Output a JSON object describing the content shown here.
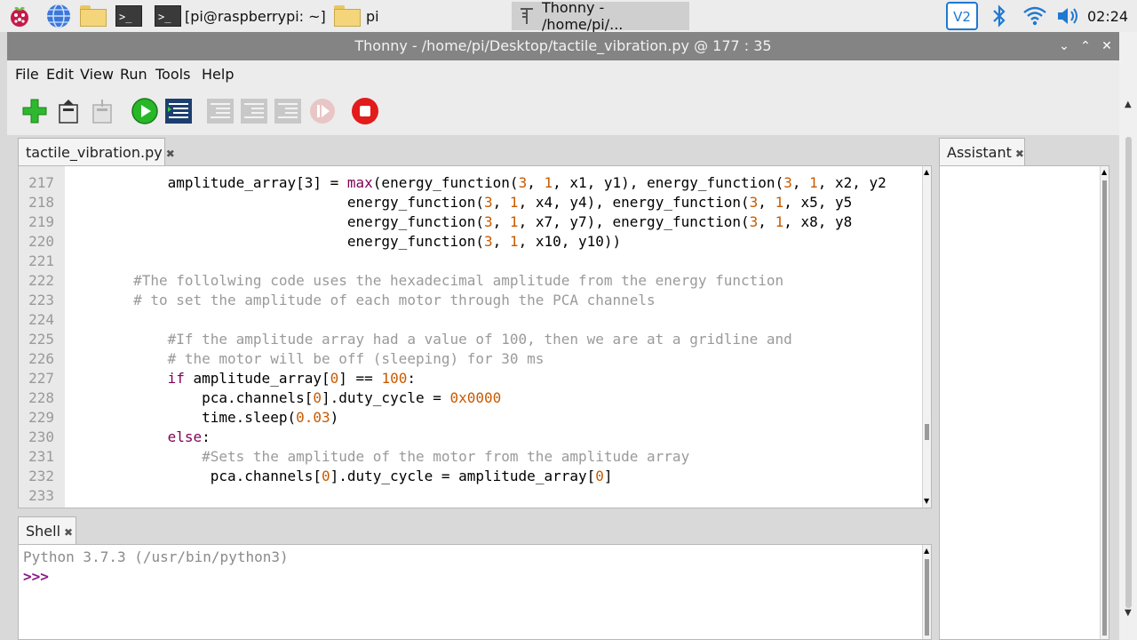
{
  "panel": {
    "tasks": [
      {
        "label": "[pi@raspberrypi: ~]",
        "icon": "terminal-icon"
      },
      {
        "label": "pi",
        "icon": "folder-icon"
      },
      {
        "label": "Thonny  -  /home/pi/...",
        "icon": "thonny-icon"
      }
    ],
    "clock": "02:24",
    "tray_icons": [
      "vnc-icon",
      "bluetooth-icon",
      "wifi-icon",
      "volume-icon"
    ],
    "launcher_icons": [
      "raspberry-menu-icon",
      "web-browser-icon",
      "file-manager-icon",
      "terminal-icon"
    ]
  },
  "window": {
    "title": "Thonny  -  /home/pi/Desktop/tactile_vibration.py  @  177 : 35"
  },
  "menu": [
    "File",
    "Edit",
    "View",
    "Run",
    "Tools",
    "Help"
  ],
  "toolbar": [
    "new-file",
    "open-file",
    "save-file",
    "run",
    "debug",
    "step-over",
    "step-into",
    "step-out",
    "resume",
    "stop"
  ],
  "editor": {
    "tab_label": "tactile_vibration.py",
    "lines": [
      {
        "n": "217",
        "segs": [
          [
            "t",
            "            amplitude_array[3] = "
          ],
          [
            "k",
            "max"
          ],
          [
            "t",
            "(energy_function("
          ],
          [
            "n",
            "3"
          ],
          [
            "t",
            ", "
          ],
          [
            "n",
            "1"
          ],
          [
            "t",
            ", x1, y1), energy_function("
          ],
          [
            "n",
            "3"
          ],
          [
            "t",
            ", "
          ],
          [
            "n",
            "1"
          ],
          [
            "t",
            ", x2, y2"
          ]
        ]
      },
      {
        "n": "218",
        "segs": [
          [
            "t",
            "                                 energy_function("
          ],
          [
            "n",
            "3"
          ],
          [
            "t",
            ", "
          ],
          [
            "n",
            "1"
          ],
          [
            "t",
            ", x4, y4), energy_function("
          ],
          [
            "n",
            "3"
          ],
          [
            "t",
            ", "
          ],
          [
            "n",
            "1"
          ],
          [
            "t",
            ", x5, y5"
          ]
        ]
      },
      {
        "n": "219",
        "segs": [
          [
            "t",
            "                                 energy_function("
          ],
          [
            "n",
            "3"
          ],
          [
            "t",
            ", "
          ],
          [
            "n",
            "1"
          ],
          [
            "t",
            ", x7, y7), energy_function("
          ],
          [
            "n",
            "3"
          ],
          [
            "t",
            ", "
          ],
          [
            "n",
            "1"
          ],
          [
            "t",
            ", x8, y8"
          ]
        ]
      },
      {
        "n": "220",
        "segs": [
          [
            "t",
            "                                 energy_function("
          ],
          [
            "n",
            "3"
          ],
          [
            "t",
            ", "
          ],
          [
            "n",
            "1"
          ],
          [
            "t",
            ", x10, y10))"
          ]
        ]
      },
      {
        "n": "221",
        "segs": []
      },
      {
        "n": "222",
        "segs": [
          [
            "c",
            "        #The follolwing code uses the hexadecimal amplitude from the energy function"
          ]
        ]
      },
      {
        "n": "223",
        "segs": [
          [
            "c",
            "        # to set the amplitude of each motor through the PCA channels"
          ]
        ]
      },
      {
        "n": "224",
        "segs": []
      },
      {
        "n": "225",
        "segs": [
          [
            "c",
            "            #If the amplitude array had a value of 100, then we are at a gridline and"
          ]
        ]
      },
      {
        "n": "226",
        "segs": [
          [
            "c",
            "            # the motor will be off (sleeping) for 30 ms"
          ]
        ]
      },
      {
        "n": "227",
        "segs": [
          [
            "t",
            "            "
          ],
          [
            "k",
            "if"
          ],
          [
            "t",
            " amplitude_array["
          ],
          [
            "n",
            "0"
          ],
          [
            "t",
            "] == "
          ],
          [
            "n",
            "100"
          ],
          [
            "t",
            ":"
          ]
        ]
      },
      {
        "n": "228",
        "segs": [
          [
            "t",
            "                pca.channels["
          ],
          [
            "n",
            "0"
          ],
          [
            "t",
            "].duty_cycle = "
          ],
          [
            "n",
            "0x0000"
          ]
        ]
      },
      {
        "n": "229",
        "segs": [
          [
            "t",
            "                time.sleep("
          ],
          [
            "n",
            "0.03"
          ],
          [
            "t",
            ")"
          ]
        ]
      },
      {
        "n": "230",
        "segs": [
          [
            "t",
            "            "
          ],
          [
            "k",
            "else"
          ],
          [
            "t",
            ":"
          ]
        ]
      },
      {
        "n": "231",
        "segs": [
          [
            "c",
            "                #Sets the amplitude of the motor from the amplitude array"
          ]
        ]
      },
      {
        "n": "232",
        "segs": [
          [
            "t",
            "                 pca.channels["
          ],
          [
            "n",
            "0"
          ],
          [
            "t",
            "].duty_cycle = amplitude_array["
          ],
          [
            "n",
            "0"
          ],
          [
            "t",
            "]"
          ]
        ]
      },
      {
        "n": "233",
        "segs": []
      }
    ]
  },
  "shell": {
    "tab_label": "Shell",
    "banner": "Python 3.7.3 (/usr/bin/python3)",
    "prompt": ">>>"
  },
  "assistant": {
    "tab_label": "Assistant"
  },
  "colors": {
    "keyword": "#7f0055",
    "number": "#c85a00",
    "comment": "#9a9a9a",
    "prompt": "#8a1a8a"
  }
}
